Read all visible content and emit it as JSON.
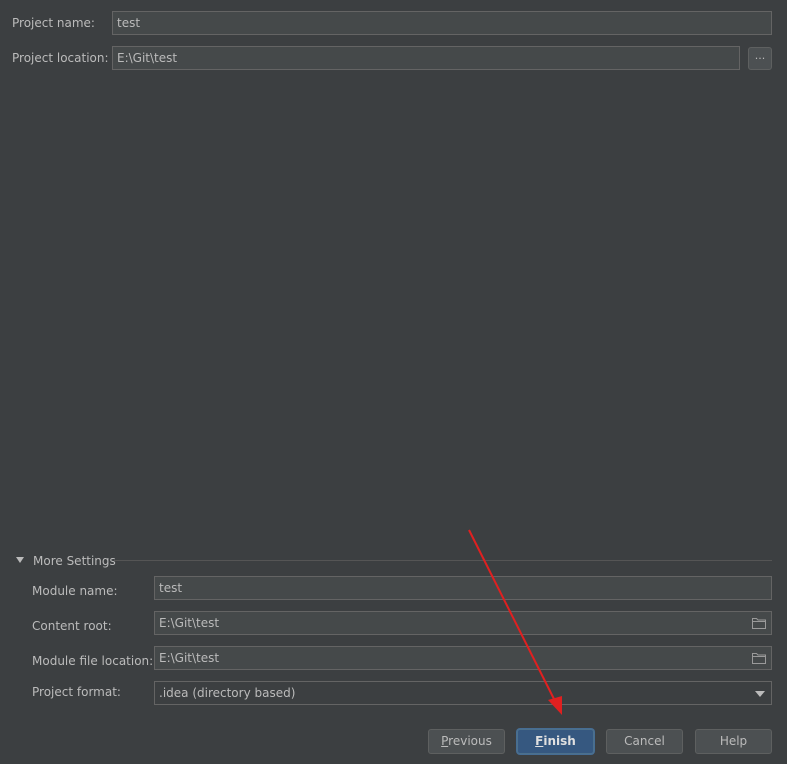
{
  "project": {
    "name_label": "Project name:",
    "name_value": "test",
    "location_label": "Project location:",
    "location_value": "E:\\Git\\test",
    "browse_label": "..."
  },
  "more_settings": {
    "title": "More Settings",
    "module_name_label": "Module name:",
    "module_name_value": "test",
    "content_root_label": "Content root:",
    "content_root_value": "E:\\Git\\test",
    "module_file_location_label": "Module file location:",
    "module_file_location_value": "E:\\Git\\test",
    "project_format_label": "Project format:",
    "project_format_value": ".idea (directory based)"
  },
  "buttons": {
    "previous_mnemonic": "P",
    "previous_rest": "revious",
    "finish_mnemonic": "F",
    "finish_rest": "inish",
    "cancel": "Cancel",
    "help": "Help"
  },
  "colors": {
    "background": "#3c3f41",
    "field_bg": "#45494a",
    "default_button": "#365880",
    "annotation_arrow": "#e02020"
  },
  "icons": [
    "folder-icon",
    "chevron-down-icon",
    "expand-triangle-icon"
  ]
}
